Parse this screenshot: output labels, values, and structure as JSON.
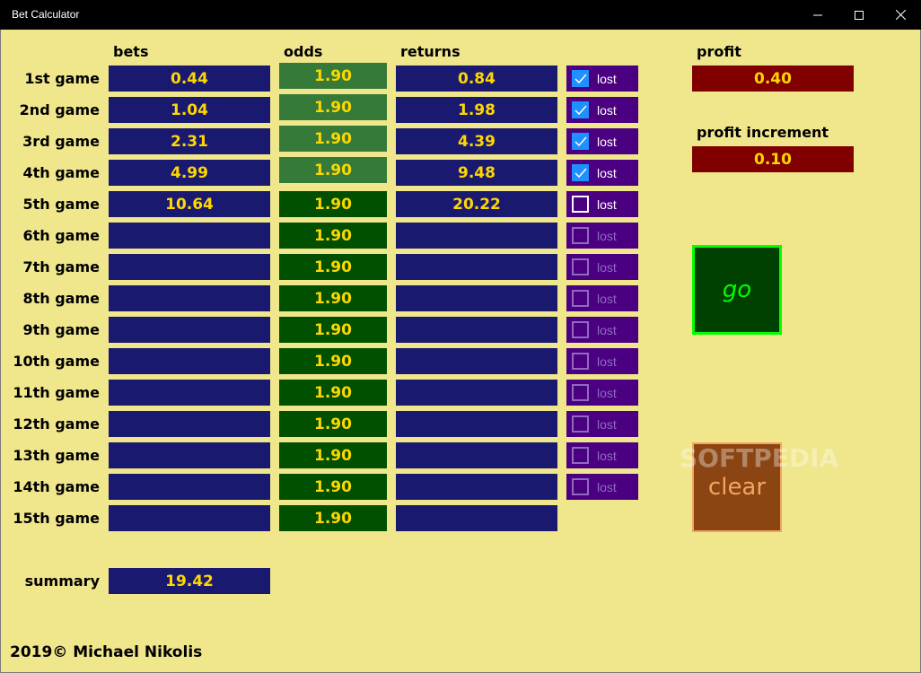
{
  "window": {
    "title": "Bet Calculator",
    "minimize_icon": "minimize-icon",
    "maximize_icon": "maximize-icon",
    "close_icon": "close-icon"
  },
  "headers": {
    "bets": "bets",
    "odds": "odds",
    "returns": "returns"
  },
  "rows": [
    {
      "label": "1st game",
      "bet": "0.44",
      "odds": "1.90",
      "returns": "0.84",
      "lost_label": "lost",
      "lost_checked": true,
      "lost_enabled": true,
      "odds_locked": true
    },
    {
      "label": "2nd game",
      "bet": "1.04",
      "odds": "1.90",
      "returns": "1.98",
      "lost_label": "lost",
      "lost_checked": true,
      "lost_enabled": true,
      "odds_locked": true
    },
    {
      "label": "3rd game",
      "bet": "2.31",
      "odds": "1.90",
      "returns": "4.39",
      "lost_label": "lost",
      "lost_checked": true,
      "lost_enabled": true,
      "odds_locked": true
    },
    {
      "label": "4th game",
      "bet": "4.99",
      "odds": "1.90",
      "returns": "9.48",
      "lost_label": "lost",
      "lost_checked": true,
      "lost_enabled": true,
      "odds_locked": true
    },
    {
      "label": "5th game",
      "bet": "10.64",
      "odds": "1.90",
      "returns": "20.22",
      "lost_label": "lost",
      "lost_checked": false,
      "lost_enabled": true,
      "odds_locked": false
    },
    {
      "label": "6th game",
      "bet": "",
      "odds": "1.90",
      "returns": "",
      "lost_label": "lost",
      "lost_checked": false,
      "lost_enabled": false,
      "odds_locked": false
    },
    {
      "label": "7th game",
      "bet": "",
      "odds": "1.90",
      "returns": "",
      "lost_label": "lost",
      "lost_checked": false,
      "lost_enabled": false,
      "odds_locked": false
    },
    {
      "label": "8th game",
      "bet": "",
      "odds": "1.90",
      "returns": "",
      "lost_label": "lost",
      "lost_checked": false,
      "lost_enabled": false,
      "odds_locked": false
    },
    {
      "label": "9th game",
      "bet": "",
      "odds": "1.90",
      "returns": "",
      "lost_label": "lost",
      "lost_checked": false,
      "lost_enabled": false,
      "odds_locked": false
    },
    {
      "label": "10th game",
      "bet": "",
      "odds": "1.90",
      "returns": "",
      "lost_label": "lost",
      "lost_checked": false,
      "lost_enabled": false,
      "odds_locked": false
    },
    {
      "label": "11th game",
      "bet": "",
      "odds": "1.90",
      "returns": "",
      "lost_label": "lost",
      "lost_checked": false,
      "lost_enabled": false,
      "odds_locked": false
    },
    {
      "label": "12th game",
      "bet": "",
      "odds": "1.90",
      "returns": "",
      "lost_label": "lost",
      "lost_checked": false,
      "lost_enabled": false,
      "odds_locked": false
    },
    {
      "label": "13th game",
      "bet": "",
      "odds": "1.90",
      "returns": "",
      "lost_label": "lost",
      "lost_checked": false,
      "lost_enabled": false,
      "odds_locked": false
    },
    {
      "label": "14th game",
      "bet": "",
      "odds": "1.90",
      "returns": "",
      "lost_label": "lost",
      "lost_checked": false,
      "lost_enabled": false,
      "odds_locked": false
    },
    {
      "label": "15th game",
      "bet": "",
      "odds": "1.90",
      "returns": "",
      "lost_label": null,
      "lost_checked": false,
      "lost_enabled": false,
      "odds_locked": false
    }
  ],
  "summary": {
    "label": "summary",
    "value": "19.42"
  },
  "profit": {
    "label": "profit",
    "value": "0.40"
  },
  "profit_increment": {
    "label": "profit increment",
    "value": "0.10"
  },
  "buttons": {
    "go": "go",
    "clear": "clear"
  },
  "watermark": "SOFTPEDIA",
  "footer": "2019© Michael Nikolis"
}
